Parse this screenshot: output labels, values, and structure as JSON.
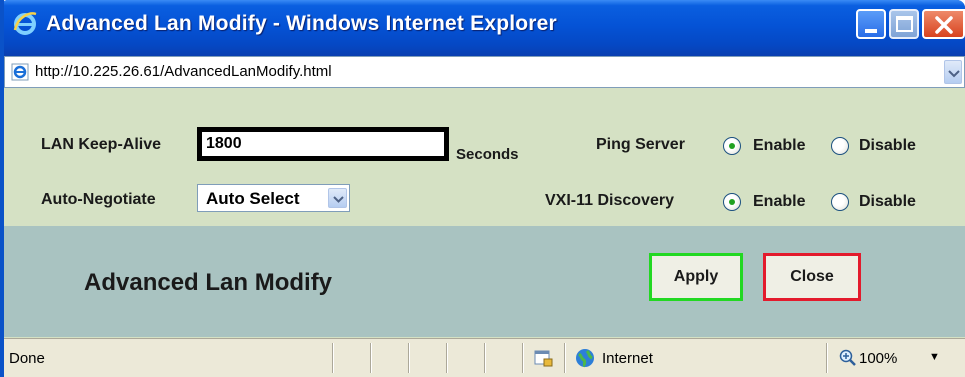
{
  "window": {
    "title": "Advanced Lan Modify - Windows Internet Explorer",
    "url": "http://10.225.26.61/AdvancedLanModify.html"
  },
  "form": {
    "keepalive_label": "LAN Keep-Alive",
    "keepalive_value": "1800",
    "keepalive_unit": "Seconds",
    "autoneg_label": "Auto-Negotiate",
    "autoneg_value": "Auto Select",
    "ping_label": "Ping Server",
    "ping_selected": "Enable",
    "vxi_label": "VXI-11 Discovery",
    "vxi_selected": "Enable",
    "enable_label": "Enable",
    "disable_label": "Disable"
  },
  "footer": {
    "heading": "Advanced Lan Modify",
    "apply_label": "Apply",
    "close_label": "Close"
  },
  "status": {
    "text": "Done",
    "zone": "Internet",
    "zoom": "100%"
  },
  "colors": {
    "titlebar": "#0553d6",
    "form_bg": "#d5e1c4",
    "footer_bg": "#a9c3c1",
    "apply_border": "#22d822",
    "close_border": "#e31a2c"
  },
  "icons": [
    "ie-logo-icon",
    "minimize-icon",
    "maximize-icon",
    "close-icon",
    "page-icon",
    "chevron-down-icon",
    "security-zone-icon",
    "globe-icon",
    "zoom-icon"
  ]
}
